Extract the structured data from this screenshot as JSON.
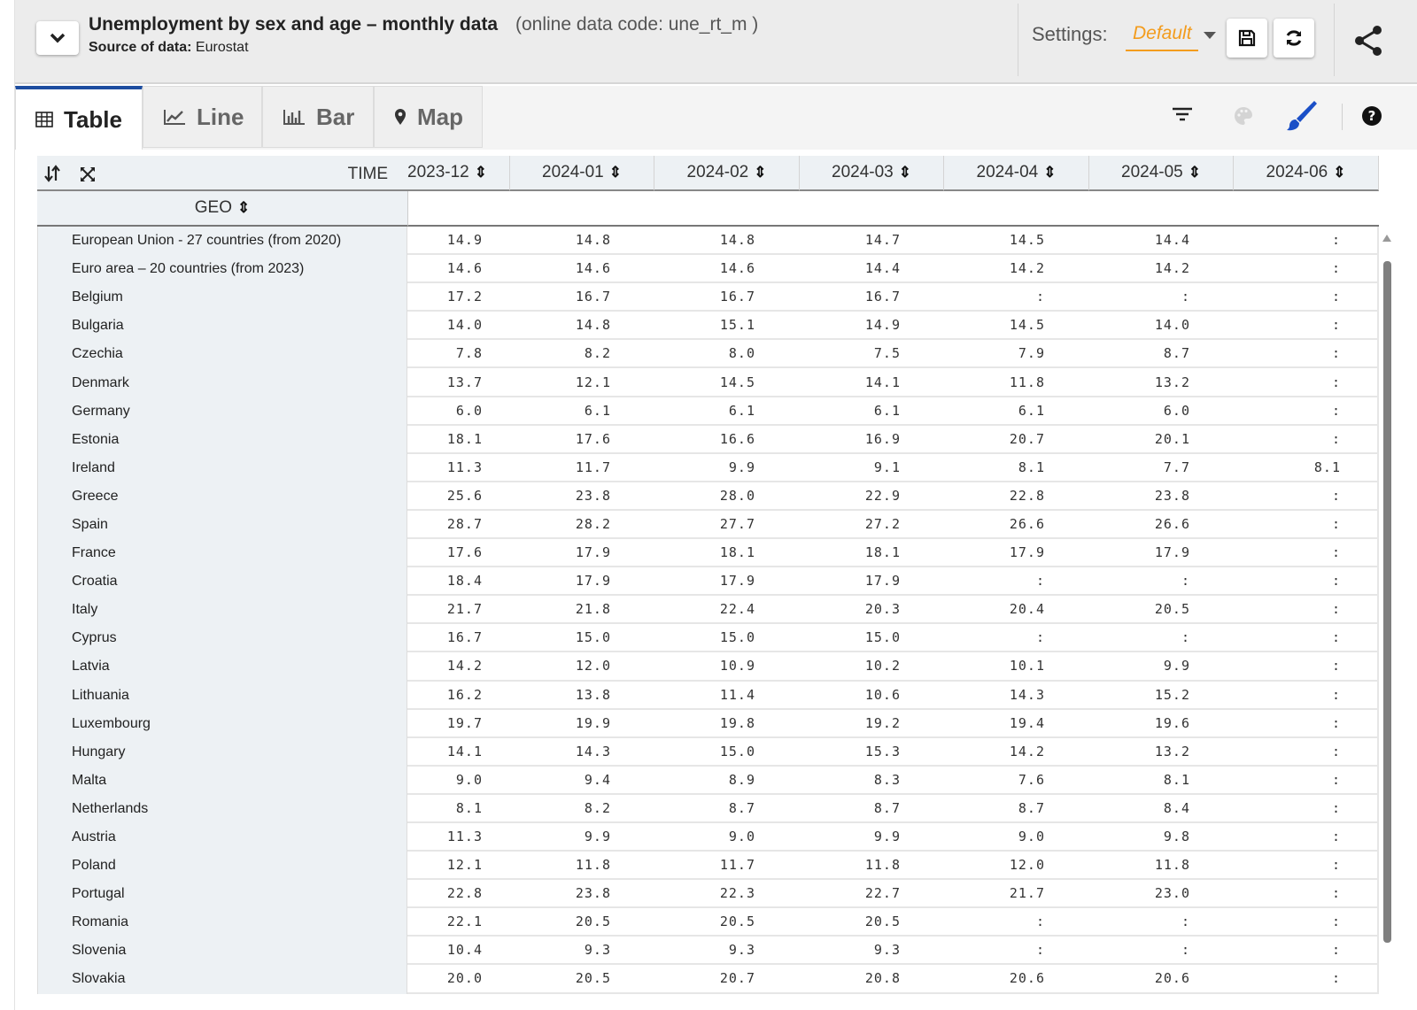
{
  "header": {
    "title": "Unemployment by sex and age – monthly data",
    "data_code": "(online data code: une_rt_m )",
    "source_label": "Source of data:",
    "source_value": "Eurostat",
    "settings_label": "Settings:",
    "settings_value": "Default",
    "accent_color": "#f39c1d"
  },
  "tabs": [
    {
      "label": "Table",
      "icon": "table-icon",
      "active": true
    },
    {
      "label": "Line",
      "icon": "line-chart-icon",
      "active": false
    },
    {
      "label": "Bar",
      "icon": "bar-chart-icon",
      "active": false
    },
    {
      "label": "Map",
      "icon": "map-pin-icon",
      "active": false
    }
  ],
  "toolbar_icons": [
    "filter-icon",
    "palette-icon",
    "brush-icon",
    "help-icon"
  ],
  "table": {
    "time_label": "TIME",
    "geo_label": "GEO",
    "columns": [
      "2023-12",
      "2024-01",
      "2024-02",
      "2024-03",
      "2024-04",
      "2024-05",
      "2024-06"
    ],
    "rows": [
      {
        "geo": "European Union - 27 countries (from 2020)",
        "values": [
          "14.9",
          "14.8",
          "14.8",
          "14.7",
          "14.5",
          "14.4",
          ":"
        ]
      },
      {
        "geo": "Euro area – 20 countries (from 2023)",
        "values": [
          "14.6",
          "14.6",
          "14.6",
          "14.4",
          "14.2",
          "14.2",
          ":"
        ]
      },
      {
        "geo": "Belgium",
        "values": [
          "17.2",
          "16.7",
          "16.7",
          "16.7",
          ":",
          ":",
          ":"
        ]
      },
      {
        "geo": "Bulgaria",
        "values": [
          "14.0",
          "14.8",
          "15.1",
          "14.9",
          "14.5",
          "14.0",
          ":"
        ]
      },
      {
        "geo": "Czechia",
        "values": [
          "7.8",
          "8.2",
          "8.0",
          "7.5",
          "7.9",
          "8.7",
          ":"
        ]
      },
      {
        "geo": "Denmark",
        "values": [
          "13.7",
          "12.1",
          "14.5",
          "14.1",
          "11.8",
          "13.2",
          ":"
        ]
      },
      {
        "geo": "Germany",
        "values": [
          "6.0",
          "6.1",
          "6.1",
          "6.1",
          "6.1",
          "6.0",
          ":"
        ]
      },
      {
        "geo": "Estonia",
        "values": [
          "18.1",
          "17.6",
          "16.6",
          "16.9",
          "20.7",
          "20.1",
          ":"
        ]
      },
      {
        "geo": "Ireland",
        "values": [
          "11.3",
          "11.7",
          "9.9",
          "9.1",
          "8.1",
          "7.7",
          "8.1"
        ]
      },
      {
        "geo": "Greece",
        "values": [
          "25.6",
          "23.8",
          "28.0",
          "22.9",
          "22.8",
          "23.8",
          ":"
        ]
      },
      {
        "geo": "Spain",
        "values": [
          "28.7",
          "28.2",
          "27.7",
          "27.2",
          "26.6",
          "26.6",
          ":"
        ]
      },
      {
        "geo": "France",
        "values": [
          "17.6",
          "17.9",
          "18.1",
          "18.1",
          "17.9",
          "17.9",
          ":"
        ]
      },
      {
        "geo": "Croatia",
        "values": [
          "18.4",
          "17.9",
          "17.9",
          "17.9",
          ":",
          ":",
          ":"
        ]
      },
      {
        "geo": "Italy",
        "values": [
          "21.7",
          "21.8",
          "22.4",
          "20.3",
          "20.4",
          "20.5",
          ":"
        ]
      },
      {
        "geo": "Cyprus",
        "values": [
          "16.7",
          "15.0",
          "15.0",
          "15.0",
          ":",
          ":",
          ":"
        ]
      },
      {
        "geo": "Latvia",
        "values": [
          "14.2",
          "12.0",
          "10.9",
          "10.2",
          "10.1",
          "9.9",
          ":"
        ]
      },
      {
        "geo": "Lithuania",
        "values": [
          "16.2",
          "13.8",
          "11.4",
          "10.6",
          "14.3",
          "15.2",
          ":"
        ]
      },
      {
        "geo": "Luxembourg",
        "values": [
          "19.7",
          "19.9",
          "19.8",
          "19.2",
          "19.4",
          "19.6",
          ":"
        ]
      },
      {
        "geo": "Hungary",
        "values": [
          "14.1",
          "14.3",
          "15.0",
          "15.3",
          "14.2",
          "13.2",
          ":"
        ]
      },
      {
        "geo": "Malta",
        "values": [
          "9.0",
          "9.4",
          "8.9",
          "8.3",
          "7.6",
          "8.1",
          ":"
        ]
      },
      {
        "geo": "Netherlands",
        "values": [
          "8.1",
          "8.2",
          "8.7",
          "8.7",
          "8.7",
          "8.4",
          ":"
        ]
      },
      {
        "geo": "Austria",
        "values": [
          "11.3",
          "9.9",
          "9.0",
          "9.9",
          "9.0",
          "9.8",
          ":"
        ]
      },
      {
        "geo": "Poland",
        "values": [
          "12.1",
          "11.8",
          "11.7",
          "11.8",
          "12.0",
          "11.8",
          ":"
        ]
      },
      {
        "geo": "Portugal",
        "values": [
          "22.8",
          "23.8",
          "22.3",
          "22.7",
          "21.7",
          "23.0",
          ":"
        ]
      },
      {
        "geo": "Romania",
        "values": [
          "22.1",
          "20.5",
          "20.5",
          "20.5",
          ":",
          ":",
          ":"
        ]
      },
      {
        "geo": "Slovenia",
        "values": [
          "10.4",
          "9.3",
          "9.3",
          "9.3",
          ":",
          ":",
          ":"
        ]
      },
      {
        "geo": "Slovakia",
        "values": [
          "20.0",
          "20.5",
          "20.7",
          "20.8",
          "20.6",
          "20.6",
          ":"
        ]
      }
    ]
  }
}
